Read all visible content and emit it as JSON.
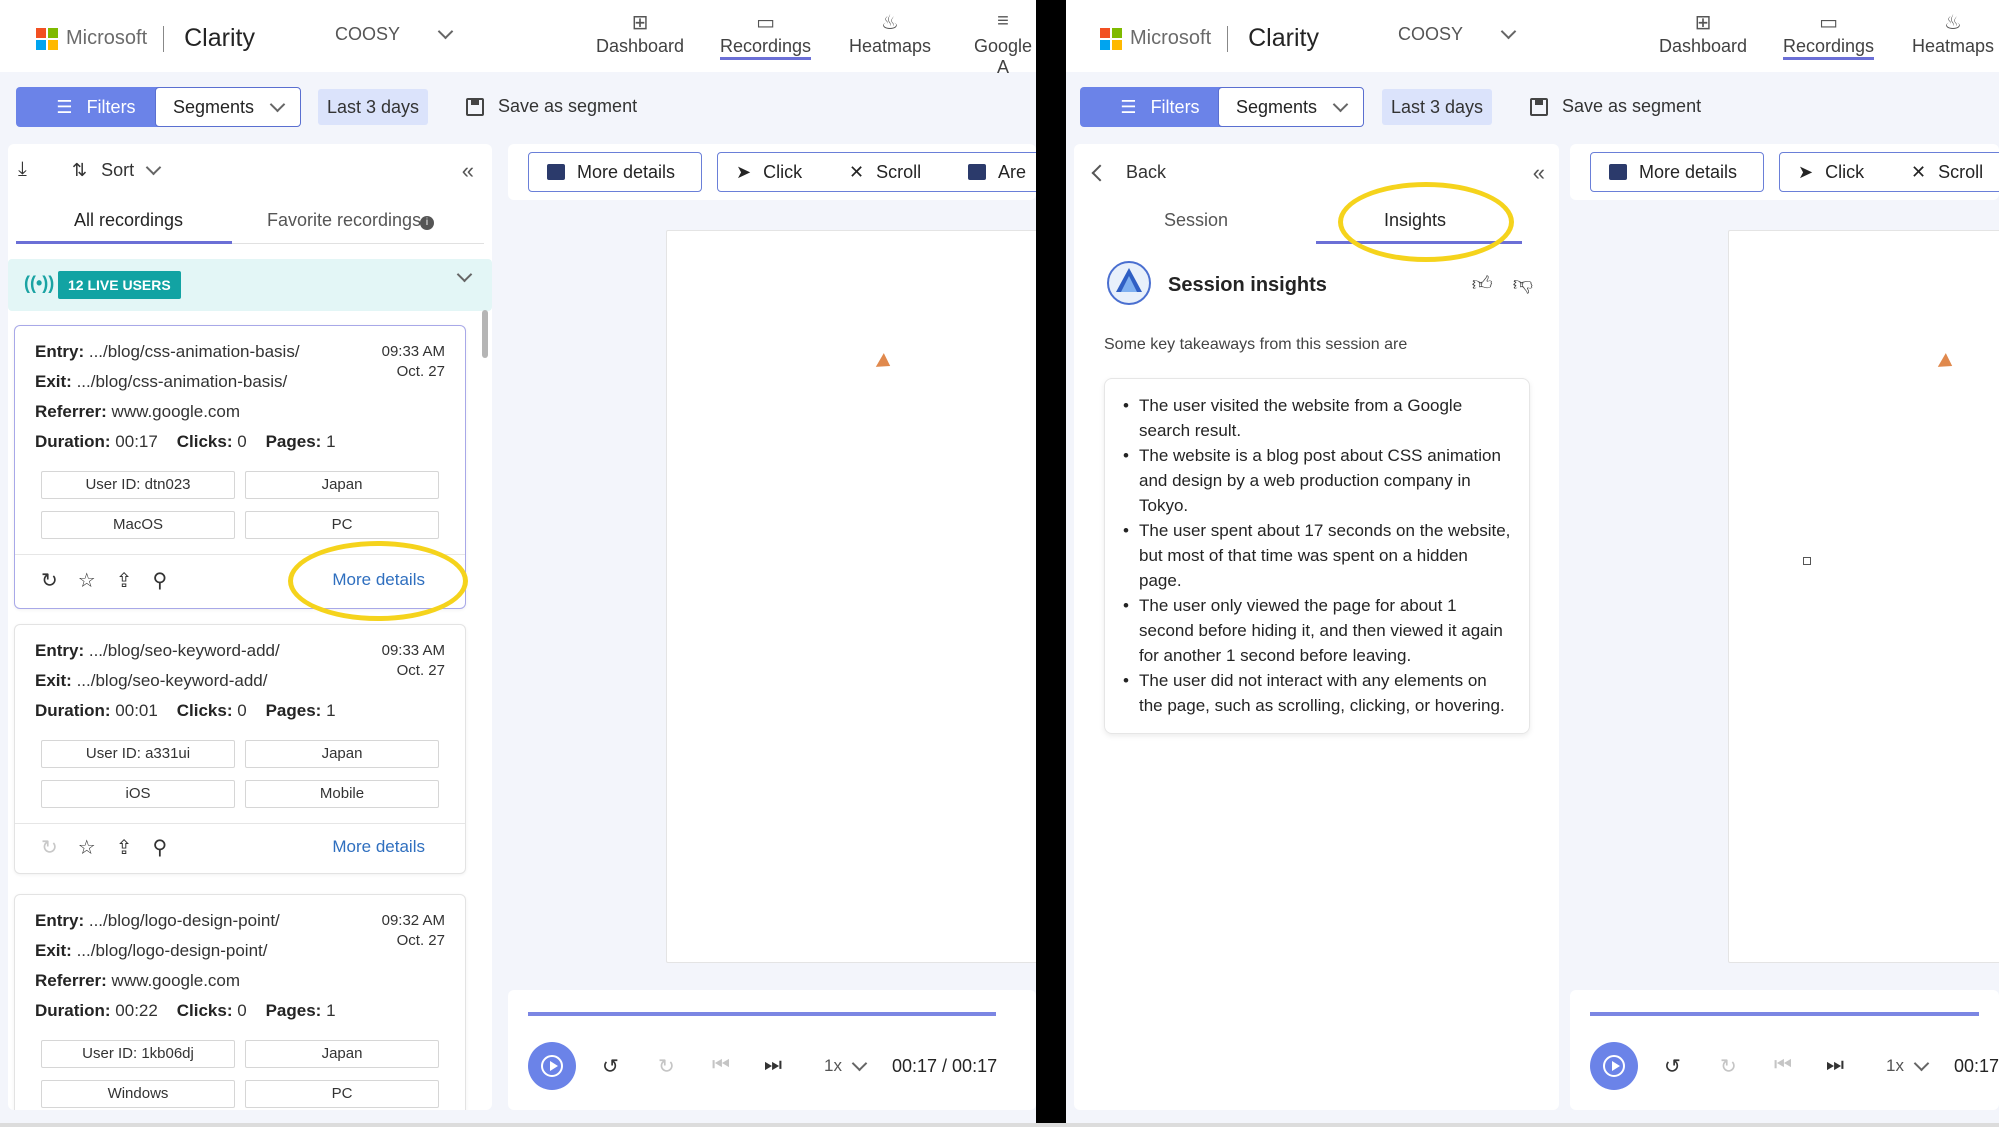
{
  "nav": {
    "brand": "Microsoft",
    "app": "Clarity",
    "project": "COOSY",
    "items": [
      {
        "label": "Dashboard",
        "icon": "dashboard-icon"
      },
      {
        "label": "Recordings",
        "icon": "video-icon"
      },
      {
        "label": "Heatmaps",
        "icon": "flame-icon"
      },
      {
        "label": "Google A",
        "icon": "analytics-icon"
      }
    ]
  },
  "filterbar": {
    "filters": "Filters",
    "segments": "Segments",
    "range": "Last 3 days",
    "save": "Save as segment"
  },
  "list": {
    "sort": "Sort",
    "tab_all": "All recordings",
    "tab_fav": "Favorite recordings",
    "live": "12 LIVE USERS",
    "cards": [
      {
        "entry_label": "Entry:",
        "entry": ".../blog/css-animation-basis/",
        "exit_label": "Exit:",
        "exit": ".../blog/css-animation-basis/",
        "ref_label": "Referrer:",
        "referrer": "www.google.com",
        "dur_label": "Duration:",
        "duration": "00:17",
        "clicks_label": "Clicks:",
        "clicks": "0",
        "pages_label": "Pages:",
        "pages": "1",
        "time": "09:33 AM",
        "date": "Oct. 27",
        "chips": [
          "User ID: dtn023",
          "Japan",
          "MacOS",
          "PC"
        ],
        "more": "More details"
      },
      {
        "entry_label": "Entry:",
        "entry": ".../blog/seo-keyword-add/",
        "exit_label": "Exit:",
        "exit": ".../blog/seo-keyword-add/",
        "dur_label": "Duration:",
        "duration": "00:01",
        "clicks_label": "Clicks:",
        "clicks": "0",
        "pages_label": "Pages:",
        "pages": "1",
        "time": "09:33 AM",
        "date": "Oct. 27",
        "chips": [
          "User ID: a331ui",
          "Japan",
          "iOS",
          "Mobile"
        ],
        "more": "More details"
      },
      {
        "entry_label": "Entry:",
        "entry": ".../blog/logo-design-point/",
        "exit_label": "Exit:",
        "exit": ".../blog/logo-design-point/",
        "ref_label": "Referrer:",
        "referrer": "www.google.com",
        "dur_label": "Duration:",
        "duration": "00:22",
        "clicks_label": "Clicks:",
        "clicks": "0",
        "pages_label": "Pages:",
        "pages": "1",
        "time": "09:32 AM",
        "date": "Oct. 27",
        "chips": [
          "User ID: 1kb06dj",
          "Japan",
          "Windows",
          "PC"
        ]
      }
    ]
  },
  "toolbar": {
    "more_details": "More details",
    "click": "Click",
    "scroll": "Scroll",
    "area": "Are"
  },
  "player": {
    "speed": "1x",
    "time": "00:17 / 00:17",
    "time_short": "00:17",
    "progress": 1.0
  },
  "insights": {
    "back": "Back",
    "tab_session": "Session",
    "tab_insights": "Insights",
    "title": "Session insights",
    "subtitle": "Some key takeaways from this session are",
    "bullets": [
      "The user visited the website from a Google search result.",
      "The website is a blog post about CSS animation and design by a web production company in Tokyo.",
      "The user spent about 17 seconds on the website, but most of that time was spent on a hidden page.",
      "The user only viewed the page for about 1 second before hiding it, and then viewed it again for another 1 second before leaving.",
      "The user did not interact with any elements on the page, such as scrolling, clicking, or hovering."
    ]
  },
  "colors": {
    "accent": "#6b83e8",
    "highlight": "#f5d31c",
    "live": "#12a3a3",
    "link": "#2f6fbf"
  }
}
